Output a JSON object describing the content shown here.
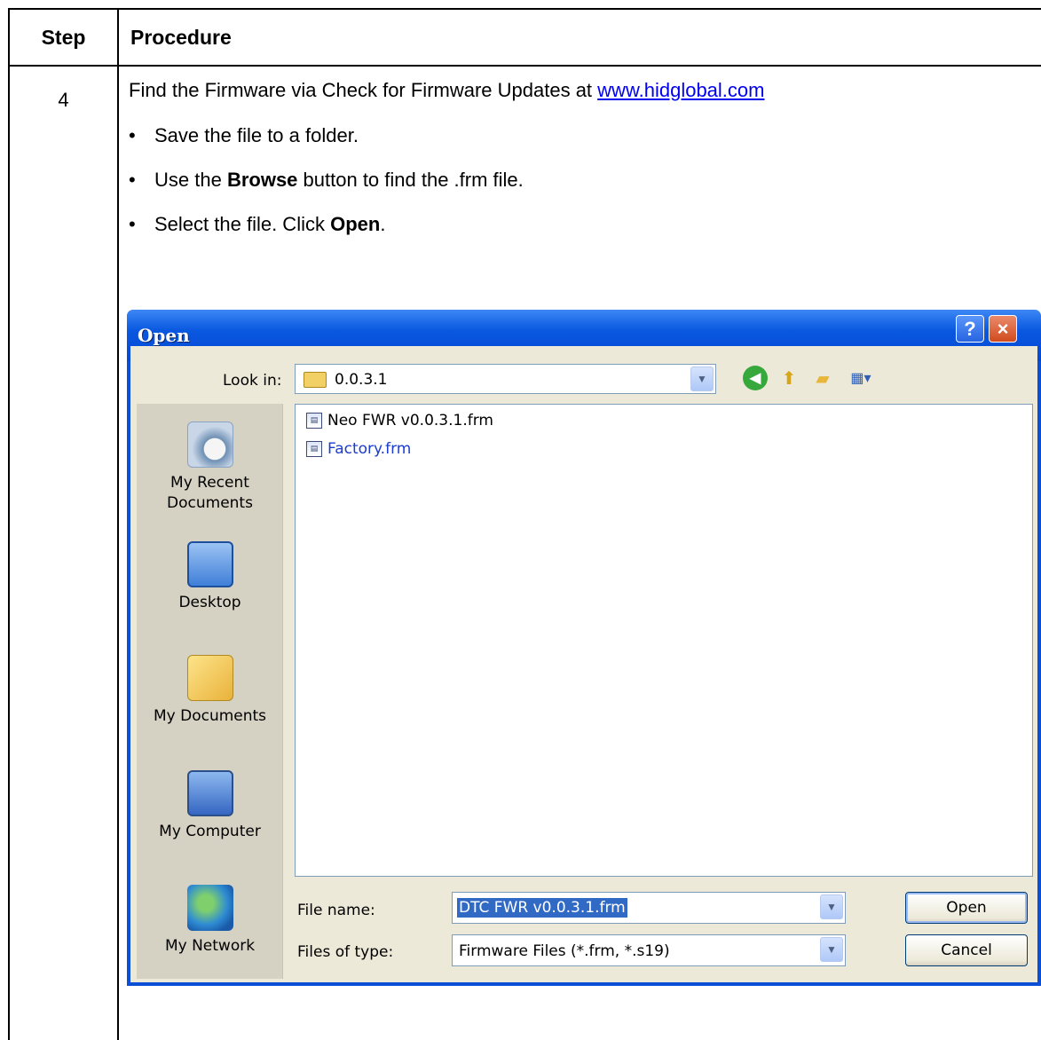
{
  "table": {
    "header_step": "Step",
    "header_procedure": "Procedure",
    "step_number": "4",
    "intro_text": "Find the Firmware via Check for Firmware Updates at ",
    "intro_link": "www.hidglobal.com",
    "bullets": [
      {
        "pre": "Save the file to a folder.",
        "bold": "",
        "post": ""
      },
      {
        "pre": "Use the ",
        "bold": "Browse",
        "post": " button to find the .frm file."
      },
      {
        "pre": "Select the file. Click ",
        "bold": "Open",
        "post": "."
      }
    ]
  },
  "dialog": {
    "title": "Open",
    "help_label": "?",
    "close_label": "×",
    "look_in_label": "Look in:",
    "look_in_value": "0.0.3.1",
    "toolbar_icons": [
      "back-icon",
      "up-folder-icon",
      "new-folder-icon",
      "views-icon"
    ],
    "places": [
      {
        "label_lines": [
          "My Recent",
          "Documents"
        ],
        "icon": "recent-documents-icon"
      },
      {
        "label_lines": [
          "Desktop"
        ],
        "icon": "desktop-icon"
      },
      {
        "label_lines": [
          "My Documents"
        ],
        "icon": "my-documents-icon"
      },
      {
        "label_lines": [
          "My Computer"
        ],
        "icon": "my-computer-icon"
      },
      {
        "label_lines": [
          "My Network"
        ],
        "icon": "my-network-icon"
      }
    ],
    "files": [
      {
        "name": "Neo FWR v0.0.3.1.frm"
      },
      {
        "name": "Factory.frm"
      }
    ],
    "file_name_label": "File name:",
    "file_name_value": "DTC FWR v0.0.3.1.frm",
    "file_type_label": "Files of type:",
    "file_type_value": "Firmware Files (*.frm, *.s19)",
    "open_button": "Open",
    "cancel_button": "Cancel"
  }
}
